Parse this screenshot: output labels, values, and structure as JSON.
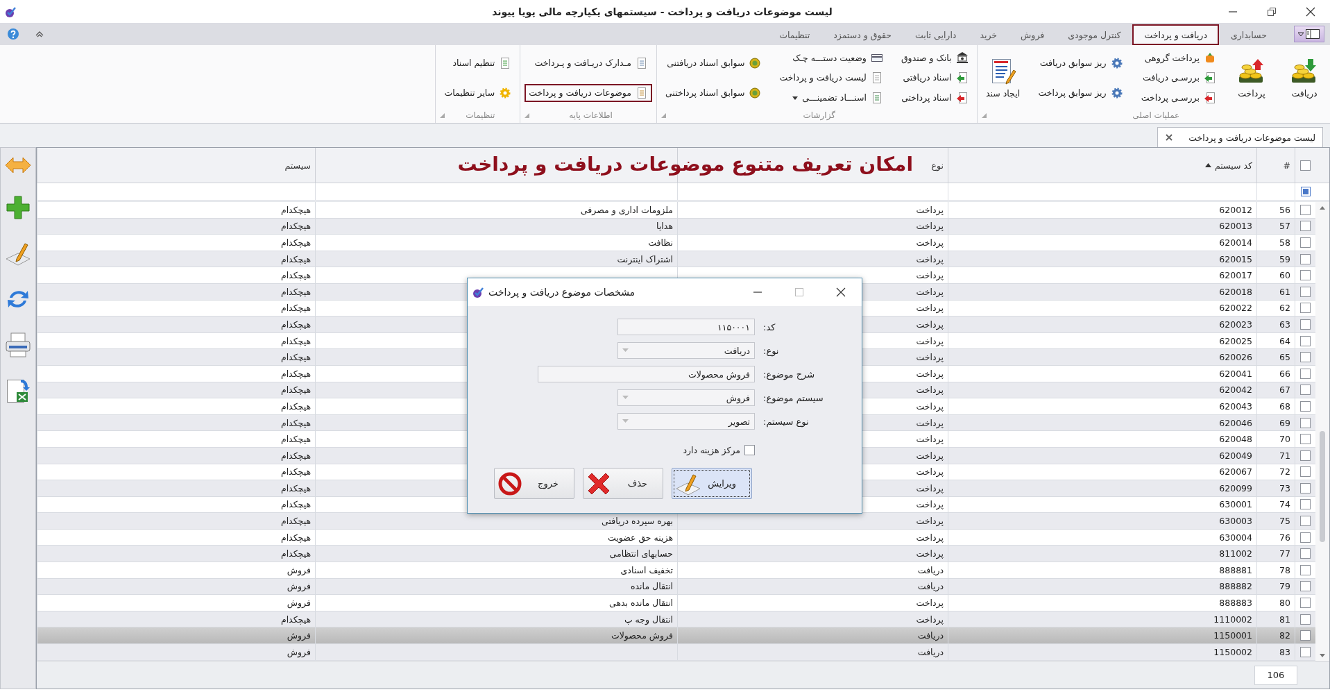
{
  "window": {
    "title": "لیست موضوعات دریافت و پرداخت - سیستمهای یکپارچه مالی پویا پیوند"
  },
  "ribbon_tabs": [
    {
      "label": "حسابداری",
      "selected": false
    },
    {
      "label": "دریافت و پرداخت",
      "selected": true
    },
    {
      "label": "کنترل موجودی",
      "selected": false
    },
    {
      "label": "فروش",
      "selected": false
    },
    {
      "label": "خرید",
      "selected": false
    },
    {
      "label": "دارایی ثابت",
      "selected": false
    },
    {
      "label": "حقوق و دستمزد",
      "selected": false
    },
    {
      "label": "تنظیمات",
      "selected": false
    }
  ],
  "ribbon_groups": [
    {
      "label": "عملیات اصلی",
      "columns": [
        [
          {
            "label": "دریافت",
            "kind": "large",
            "highlighted": false
          }
        ],
        [
          {
            "label": "پرداخت",
            "kind": "large",
            "highlighted": false
          }
        ],
        [
          {
            "label": "پرداخت گروهی",
            "kind": "small",
            "highlighted": false
          },
          {
            "label": "بررسـی دریافت",
            "kind": "small",
            "highlighted": false
          },
          {
            "label": "بررسـی پرداخت",
            "kind": "small",
            "highlighted": false
          }
        ],
        [
          {
            "label": "ریز سوابق دریافت",
            "kind": "small",
            "highlighted": false
          },
          {
            "label": "ریز سوابق پرداخت",
            "kind": "small",
            "highlighted": false
          }
        ],
        [
          {
            "label": "ایجاد سند",
            "kind": "large",
            "highlighted": false
          }
        ]
      ]
    },
    {
      "label": "گزارشات",
      "columns": [
        [
          {
            "label": "بانک و صندوق",
            "kind": "small",
            "highlighted": false
          },
          {
            "label": "اسناد دریافتی",
            "kind": "small",
            "highlighted": false
          },
          {
            "label": "اسناد پرداختی",
            "kind": "small",
            "highlighted": false
          }
        ],
        [
          {
            "label": "وضعیت دستـــه چـک",
            "kind": "small",
            "highlighted": false
          },
          {
            "label": "لیست دریافت و پرداخت",
            "kind": "small",
            "highlighted": false
          },
          {
            "label": "اسنـــاد تضمینـــی",
            "kind": "dropdown",
            "highlighted": false
          }
        ],
        [
          {
            "label": "سوابق اسناد دریافتنی",
            "kind": "small",
            "highlighted": false
          },
          {
            "label": "سوابق اسناد پرداختنی",
            "kind": "small",
            "highlighted": false
          }
        ]
      ]
    },
    {
      "label": "اطلاعات پایه",
      "columns": [
        [
          {
            "label": "مـدارک دریـافت و پـرداخت",
            "kind": "small",
            "highlighted": false
          },
          {
            "label": "موضوعات دریافت و پرداخت",
            "kind": "small",
            "highlighted": true
          }
        ]
      ]
    },
    {
      "label": "تنظیمات",
      "columns": [
        [
          {
            "label": "تنظیم اسناد",
            "kind": "small",
            "highlighted": false
          },
          {
            "label": "سایر تنظیمات",
            "kind": "small",
            "highlighted": false
          }
        ]
      ]
    }
  ],
  "document_tabs": [
    {
      "label": "لیست موضوعات دریافت و پرداخت",
      "selected": true
    }
  ],
  "overlay_caption": "امکان تعریف متنوع موضوعات دریافت و پرداخت",
  "table": {
    "select_all": {
      "checked": false
    },
    "columns": [
      {
        "label": "#",
        "sorted": false
      },
      {
        "label": "کد سیستم",
        "sorted": true
      },
      {
        "label": "نوع",
        "sorted": false
      },
      {
        "sorted": false
      },
      {
        "label": "سیستم",
        "sorted": false
      }
    ],
    "rows": [
      {
        "checked": false,
        "selected": false,
        "number": "56",
        "code": "620012",
        "type": "پرداخت",
        "description": "ملزومات اداری و مصرفی",
        "system": "هیچکدام"
      },
      {
        "checked": false,
        "selected": false,
        "number": "57",
        "code": "620013",
        "type": "پرداخت",
        "description": "هدایا",
        "system": "هیچکدام"
      },
      {
        "checked": false,
        "selected": false,
        "number": "58",
        "code": "620014",
        "type": "پرداخت",
        "description": "نظافت",
        "system": "هیچکدام"
      },
      {
        "checked": false,
        "selected": false,
        "number": "59",
        "code": "620015",
        "type": "پرداخت",
        "description": "اشتراک اینترنت",
        "system": "هیچکدام"
      },
      {
        "checked": false,
        "selected": false,
        "number": "60",
        "code": "620017",
        "type": "پرداخت",
        "system": "هیچکدام"
      },
      {
        "checked": false,
        "selected": false,
        "number": "61",
        "code": "620018",
        "type": "پرداخت",
        "system": "هیچکدام"
      },
      {
        "checked": false,
        "selected": false,
        "number": "62",
        "code": "620022",
        "type": "پرداخت",
        "system": "هیچکدام"
      },
      {
        "checked": false,
        "selected": false,
        "number": "63",
        "code": "620023",
        "type": "پرداخت",
        "system": "هیچکدام"
      },
      {
        "checked": false,
        "selected": false,
        "number": "64",
        "code": "620025",
        "type": "پرداخت",
        "system": "هیچکدام"
      },
      {
        "checked": false,
        "selected": false,
        "number": "65",
        "code": "620026",
        "type": "پرداخت",
        "system": "هیچکدام"
      },
      {
        "checked": false,
        "selected": false,
        "number": "66",
        "code": "620041",
        "type": "پرداخت",
        "system": "هیچکدام"
      },
      {
        "checked": false,
        "selected": false,
        "number": "67",
        "code": "620042",
        "type": "پرداخت",
        "system": "هیچکدام"
      },
      {
        "checked": false,
        "selected": false,
        "number": "68",
        "code": "620043",
        "type": "پرداخت",
        "system": "هیچکدام"
      },
      {
        "checked": false,
        "selected": false,
        "number": "69",
        "code": "620046",
        "type": "پرداخت",
        "system": "هیچکدام"
      },
      {
        "checked": false,
        "selected": false,
        "number": "70",
        "code": "620048",
        "type": "پرداخت",
        "system": "هیچکدام"
      },
      {
        "checked": false,
        "selected": false,
        "number": "71",
        "code": "620049",
        "type": "پرداخت",
        "system": "هیچکدام"
      },
      {
        "checked": false,
        "selected": false,
        "number": "72",
        "code": "620067",
        "type": "پرداخت",
        "system": "هیچکدام"
      },
      {
        "checked": false,
        "selected": false,
        "number": "73",
        "code": "620099",
        "type": "پرداخت",
        "system": "هیچکدام"
      },
      {
        "checked": false,
        "selected": false,
        "number": "74",
        "code": "630001",
        "type": "پرداخت",
        "system": "هیچکدام"
      },
      {
        "checked": false,
        "selected": false,
        "number": "75",
        "code": "630003",
        "type": "پرداخت",
        "description": "بهره سپرده دریافتی",
        "system": "هیچکدام"
      },
      {
        "checked": false,
        "selected": false,
        "number": "76",
        "code": "630004",
        "type": "پرداخت",
        "description": "هزینه حق عضویت",
        "system": "هیچکدام"
      },
      {
        "checked": false,
        "selected": false,
        "number": "77",
        "code": "811002",
        "type": "پرداخت",
        "description": "حسابهای انتظامی",
        "system": "هیچکدام"
      },
      {
        "checked": false,
        "selected": false,
        "number": "78",
        "code": "888881",
        "type": "دریافت",
        "description": "تخفیف اسنادی",
        "system": "فروش"
      },
      {
        "checked": false,
        "selected": false,
        "number": "79",
        "code": "888882",
        "type": "دریافت",
        "description": "انتقال مانده",
        "system": "فروش"
      },
      {
        "checked": false,
        "selected": false,
        "number": "80",
        "code": "888883",
        "type": "پرداخت",
        "description": "انتقال مانده بدهی",
        "system": "فروش"
      },
      {
        "checked": false,
        "selected": false,
        "number": "81",
        "code": "1110002",
        "type": "پرداخت",
        "description": "انتقال وجه پ",
        "system": "هیچکدام"
      },
      {
        "checked": false,
        "selected": true,
        "number": "82",
        "code": "1150001",
        "type": "دریافت",
        "description": "فروش  محصولات",
        "system": "فروش"
      },
      {
        "checked": false,
        "selected": false,
        "number": "83",
        "code": "1150002",
        "type": "دریافت",
        "system": "فروش"
      }
    ],
    "record_count": "106"
  },
  "dialog": {
    "title": "مشخصات موضوع دریافت و پرداخت",
    "fields": [
      {
        "label": "کد:",
        "value": "۱۱۵۰۰۰۱",
        "kind": "text"
      },
      {
        "label": "نوع:",
        "value": "دریافت",
        "kind": "dropdown"
      },
      {
        "label": "شرح موضوع:",
        "value": "فروش  محصولات",
        "kind": "wide"
      },
      {
        "label": "سیستم موضوع:",
        "value": "فروش",
        "kind": "dropdown"
      },
      {
        "label": "نوع سیستم:",
        "value": "تصویر",
        "kind": "dropdown"
      }
    ],
    "checkbox": {
      "label": "مرکز هزینه دارد",
      "checked": false
    },
    "buttons": [
      {
        "label": "ویرایش",
        "focused": true
      },
      {
        "label": "حذف",
        "focused": false
      },
      {
        "label": "خروج",
        "focused": false
      }
    ]
  }
}
